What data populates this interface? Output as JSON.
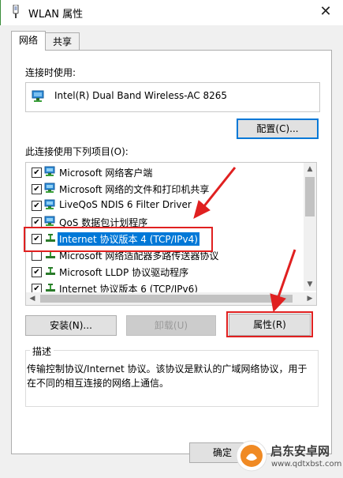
{
  "window": {
    "title": "WLAN 属性",
    "close_glyph": "✕"
  },
  "tabs": [
    {
      "label": "网络",
      "active": true
    },
    {
      "label": "共享",
      "active": false
    }
  ],
  "connect_using": {
    "label": "连接时使用:",
    "adapter": "Intel(R) Dual Band Wireless-AC 8265",
    "configure_button": "配置(C)..."
  },
  "items_section": {
    "label": "此连接使用下列项目(O):",
    "items": [
      {
        "text": "Microsoft 网络客户端",
        "checked": true,
        "selected": false,
        "icon": "network-client-icon"
      },
      {
        "text": "Microsoft 网络的文件和打印机共享",
        "checked": true,
        "selected": false,
        "icon": "network-client-icon"
      },
      {
        "text": "LiveQoS NDIS 6 Filter Driver",
        "checked": true,
        "selected": false,
        "icon": "network-client-icon"
      },
      {
        "text": "QoS 数据包计划程序",
        "checked": true,
        "selected": false,
        "icon": "network-client-icon"
      },
      {
        "text": "Internet 协议版本 4 (TCP/IPv4)",
        "checked": true,
        "selected": true,
        "icon": "protocol-icon"
      },
      {
        "text": "Microsoft 网络适配器多路传送器协议",
        "checked": false,
        "selected": false,
        "icon": "protocol-icon"
      },
      {
        "text": "Microsoft LLDP 协议驱动程序",
        "checked": true,
        "selected": false,
        "icon": "protocol-icon"
      },
      {
        "text": "Internet 协议版本 6 (TCP/IPv6)",
        "checked": true,
        "selected": false,
        "icon": "protocol-icon"
      }
    ],
    "check_glyph": "✔"
  },
  "buttons": {
    "install": "安装(N)...",
    "uninstall": "卸载(U)",
    "properties": "属性(R)"
  },
  "description": {
    "legend": "描述",
    "text": "传输控制协议/Internet 协议。该协议是默认的广域网络协议，用于在不同的相互连接的网络上通信。"
  },
  "footer": {
    "ok": "确定"
  },
  "watermark": {
    "name": "启东安卓网",
    "url": "www.qdtxbst.com"
  },
  "colors": {
    "selection": "#0078d7",
    "annotation": "#e02020",
    "watermark_orange": "#f08a24"
  }
}
